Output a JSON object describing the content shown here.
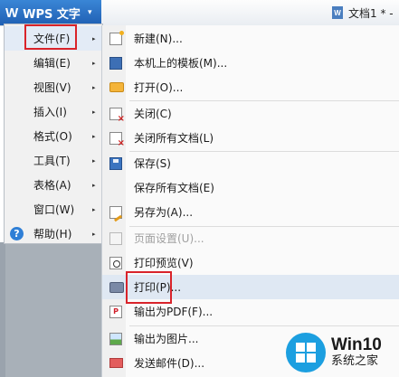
{
  "app": {
    "title": "WPS 文字",
    "logo_glyph": "W",
    "caret": "▾"
  },
  "document_tab": {
    "icon_label": "W",
    "title": "文档1 * -"
  },
  "main_menu": {
    "items": [
      {
        "label": "文件(F)",
        "icon": ""
      },
      {
        "label": "编辑(E)",
        "icon": ""
      },
      {
        "label": "视图(V)",
        "icon": ""
      },
      {
        "label": "插入(I)",
        "icon": ""
      },
      {
        "label": "格式(O)",
        "icon": ""
      },
      {
        "label": "工具(T)",
        "icon": ""
      },
      {
        "label": "表格(A)",
        "icon": ""
      },
      {
        "label": "窗口(W)",
        "icon": ""
      },
      {
        "label": "帮助(H)",
        "icon": "help-icon"
      }
    ],
    "submenu_arrow": "▸",
    "help_glyph": "?"
  },
  "file_menu": {
    "items": [
      {
        "label": "新建(N)...",
        "icon": "new-document-icon",
        "enabled": true
      },
      {
        "label": "本机上的模板(M)...",
        "icon": "template-icon",
        "enabled": true
      },
      {
        "label": "打开(O)...",
        "icon": "open-folder-icon",
        "enabled": true
      },
      {
        "label": "关闭(C)",
        "icon": "close-document-icon",
        "enabled": true
      },
      {
        "label": "关闭所有文档(L)",
        "icon": "close-all-documents-icon",
        "enabled": true
      },
      {
        "label": "保存(S)",
        "icon": "save-icon",
        "enabled": true
      },
      {
        "label": "保存所有文档(E)",
        "icon": "",
        "enabled": true
      },
      {
        "label": "另存为(A)...",
        "icon": "save-as-icon",
        "enabled": true
      },
      {
        "label": "页面设置(U)...",
        "icon": "page-setup-icon",
        "enabled": false
      },
      {
        "label": "打印预览(V)",
        "icon": "print-preview-icon",
        "enabled": true
      },
      {
        "label": "打印(P)...",
        "icon": "printer-icon",
        "enabled": true,
        "highlighted": true
      },
      {
        "label": "输出为PDF(F)...",
        "icon": "pdf-export-icon",
        "enabled": true
      },
      {
        "label": "输出为图片...",
        "icon": "image-export-icon",
        "enabled": true
      },
      {
        "label": "发送邮件(D)...",
        "icon": "send-mail-icon",
        "enabled": true
      }
    ],
    "pdf_glyph": "P"
  },
  "watermark": {
    "title": "Win10",
    "subtitle": "系统之家"
  },
  "colors": {
    "highlight_box": "#d9232a",
    "app_button": "#2a6fc4",
    "menu_hover": "#dfe8f3"
  }
}
